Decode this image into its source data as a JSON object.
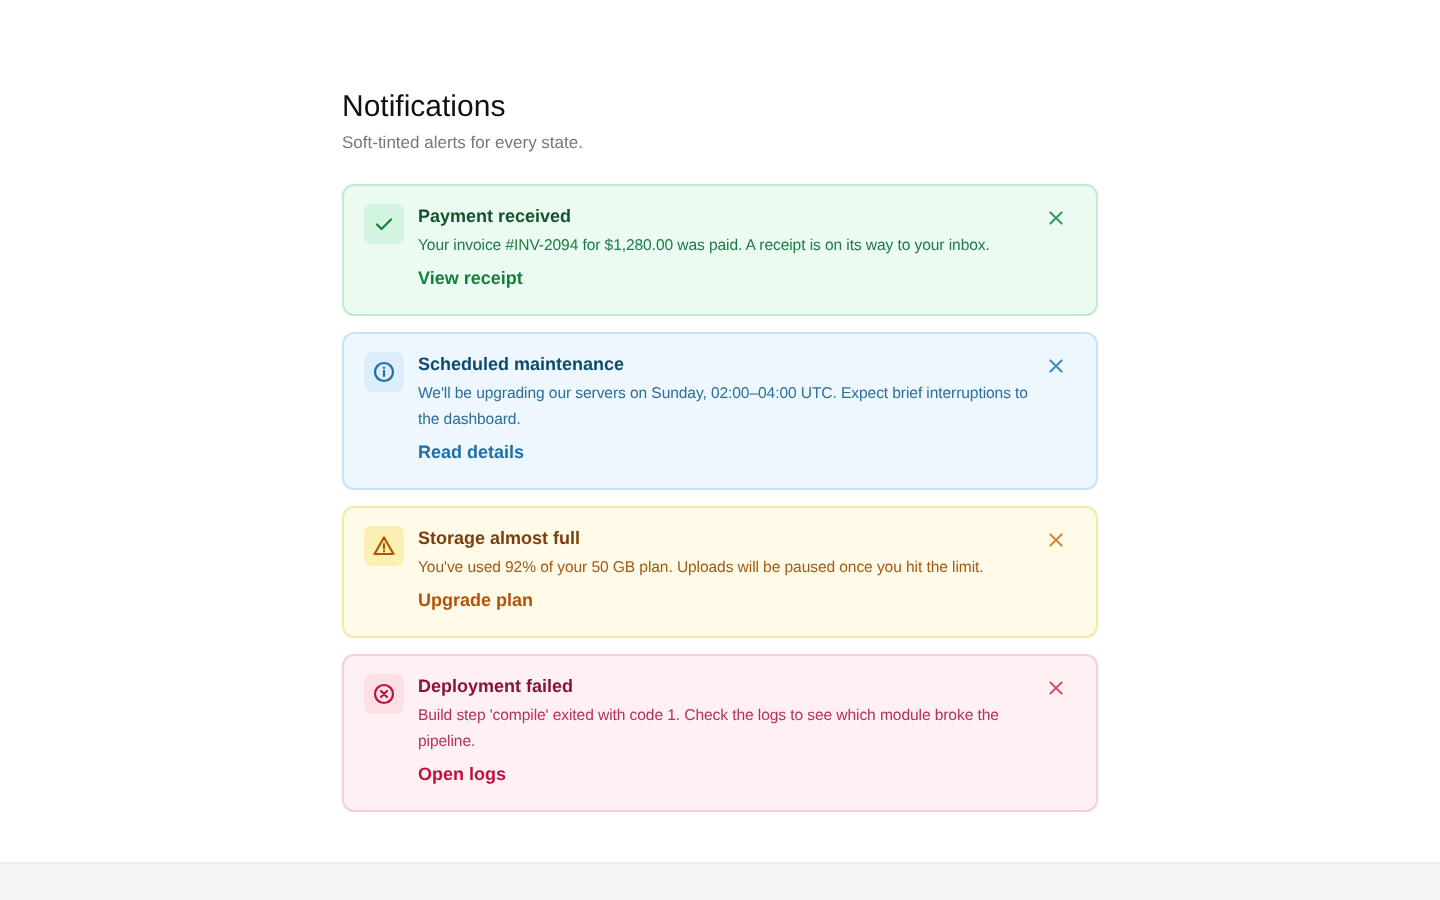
{
  "header": {
    "title": "Notifications",
    "subtitle": "Soft-tinted alerts for every state."
  },
  "alerts": [
    {
      "kind": "success",
      "title": "Payment received",
      "message": "Your invoice #INV-2094 for $1,280.00 was paid. A receipt is on its way to your inbox.",
      "action": "View receipt"
    },
    {
      "kind": "info",
      "title": "Scheduled maintenance",
      "message": "We'll be upgrading our servers on Sunday, 02:00–04:00 UTC. Expect brief interruptions to the dashboard.",
      "action": "Read details"
    },
    {
      "kind": "warning",
      "title": "Storage almost full",
      "message": "You've used 92% of your 50 GB plan. Uploads will be paused once you hit the limit.",
      "action": "Upgrade plan"
    },
    {
      "kind": "error",
      "title": "Deployment failed",
      "message": "Build step 'compile' exited with code 1. Check the logs to see which module broke the pipeline.",
      "action": "Open logs"
    }
  ]
}
